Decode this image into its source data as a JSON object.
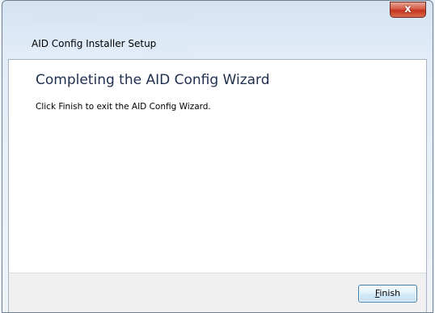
{
  "window": {
    "title": "AID Config Installer Setup",
    "close_glyph": "x",
    "close_icon": "close-icon"
  },
  "page": {
    "heading": "Completing the AID Config Wizard",
    "body_text": "Click Finish to exit the AID Config Wizard."
  },
  "buttons": {
    "finish_mnemonic": "F",
    "finish_rest": "inish"
  },
  "colors": {
    "heading": "#1f2f4d",
    "close_button": "#c4341c",
    "button_border": "#3c7fb1"
  }
}
